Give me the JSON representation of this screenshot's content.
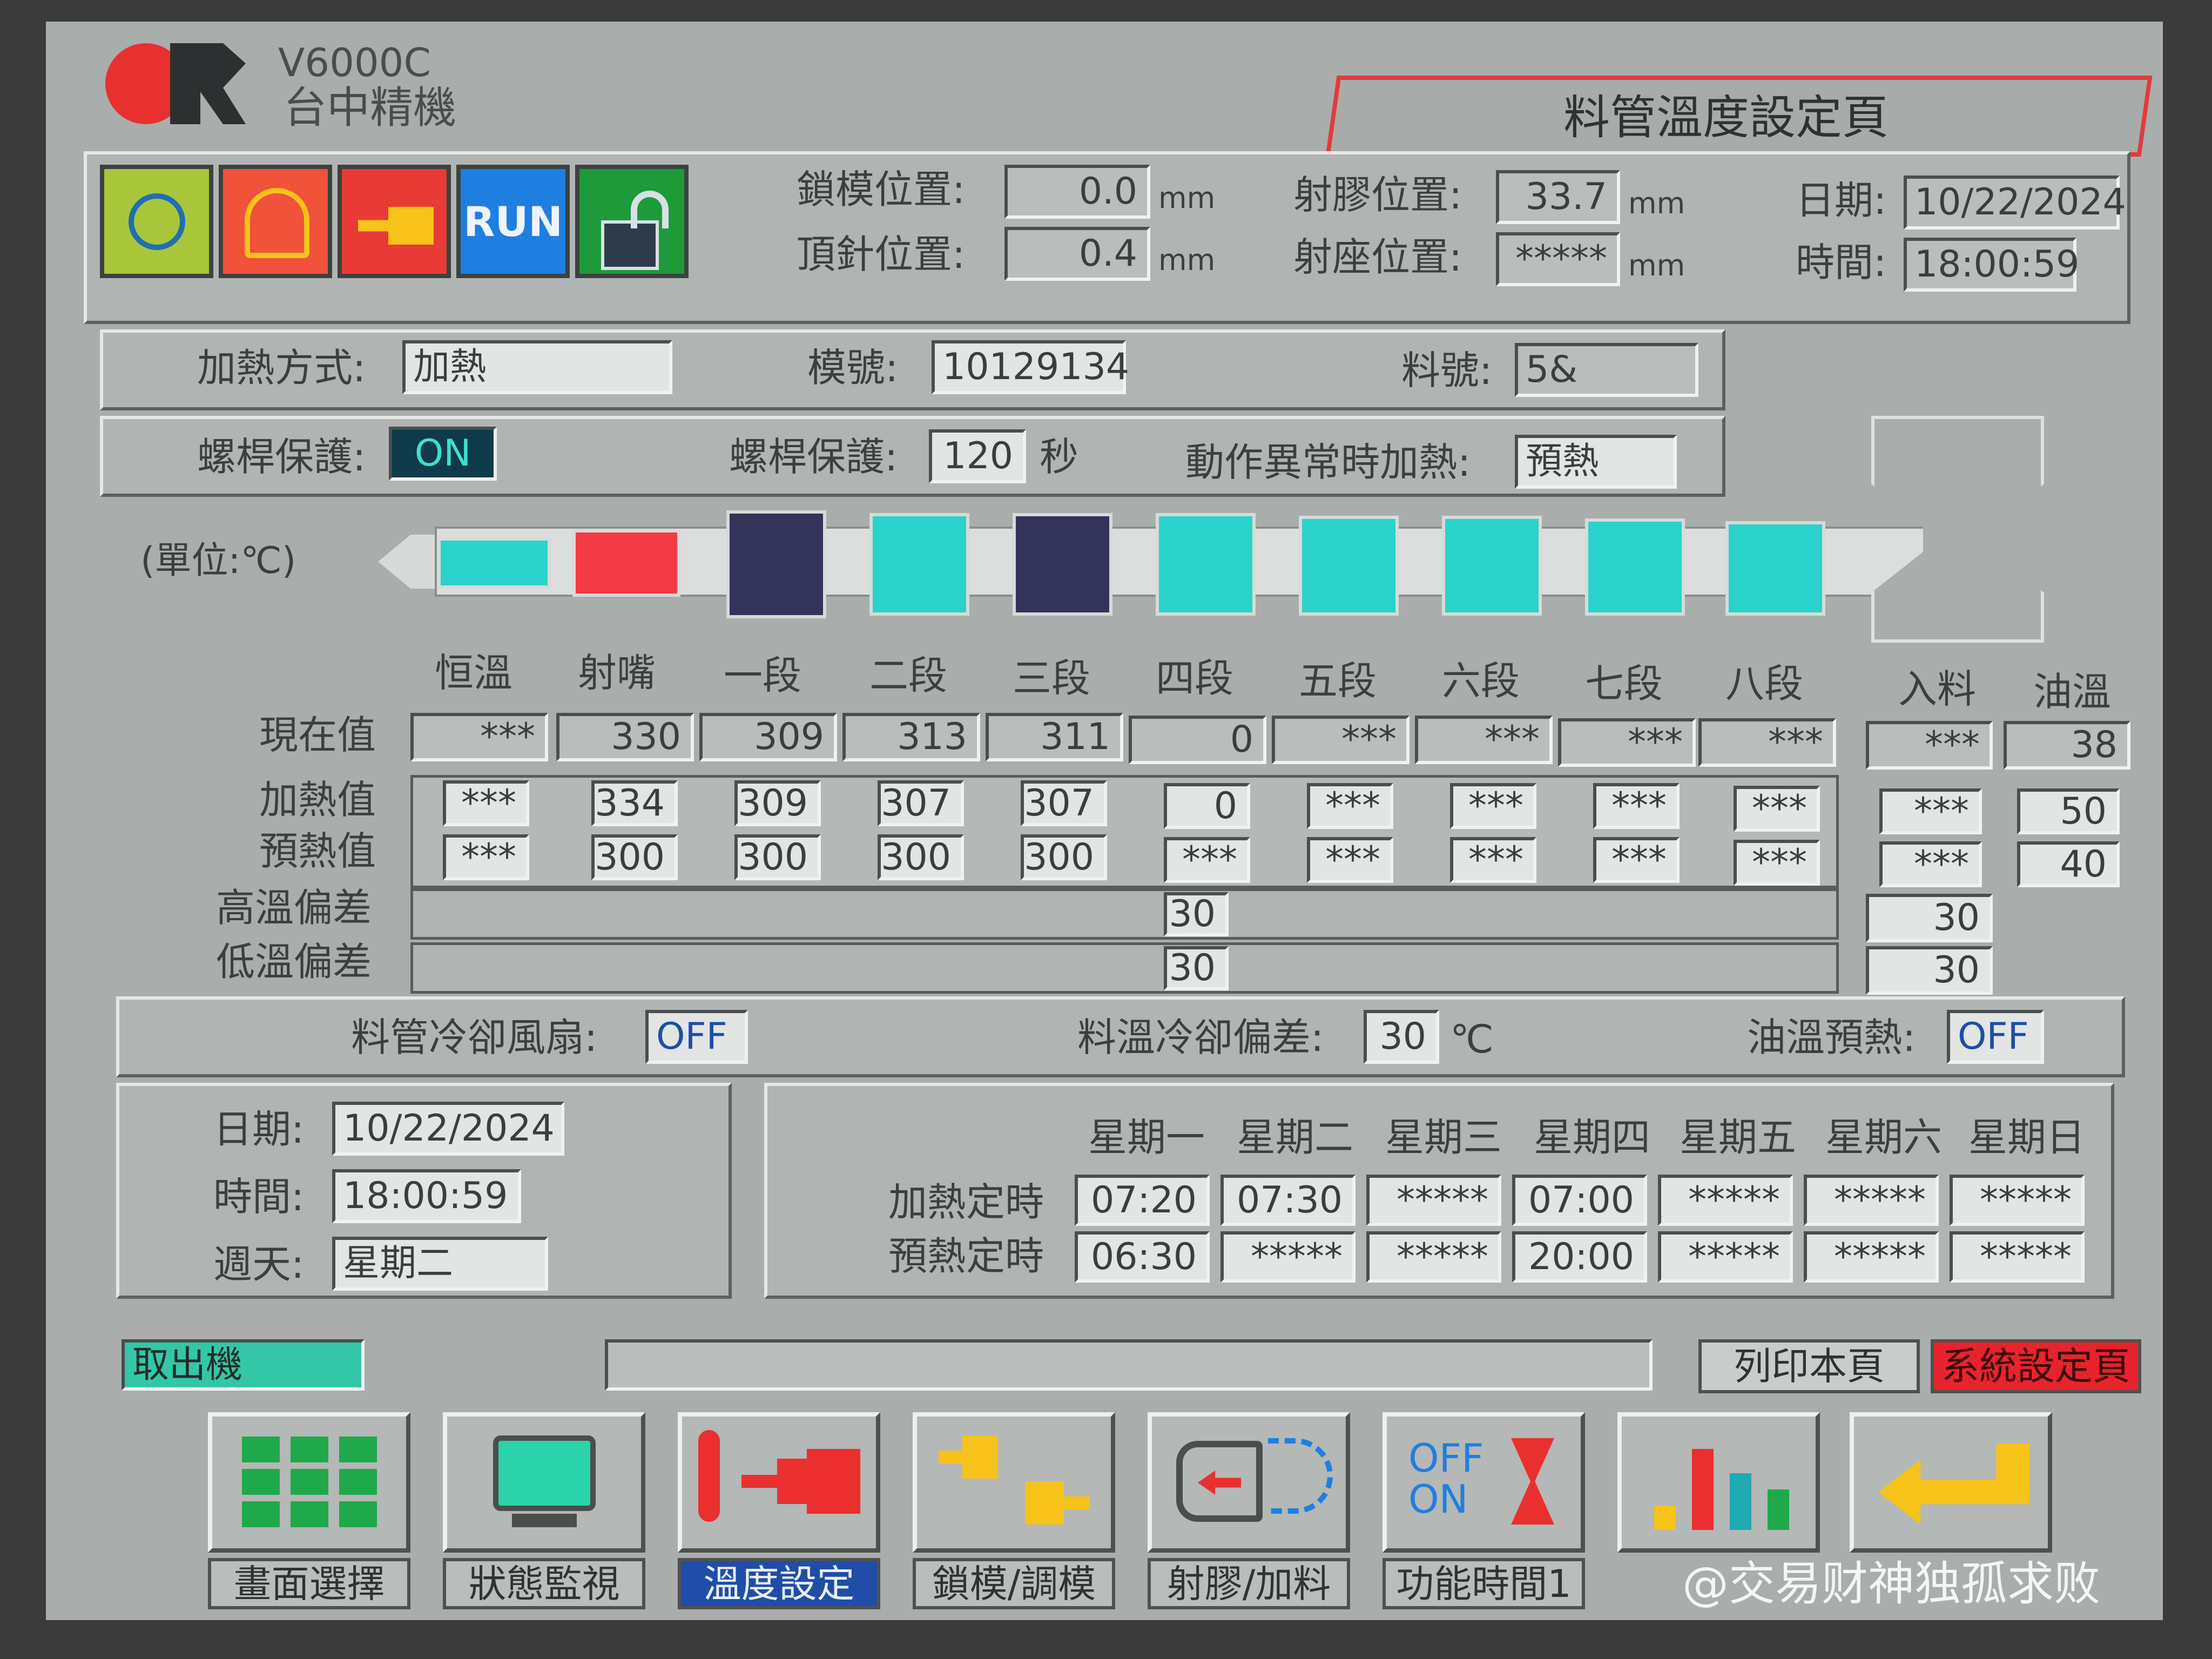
{
  "brand": {
    "model": "V6000C",
    "company": "台中精機"
  },
  "page_title": "料管溫度設定頁",
  "status_icons": {
    "run_label": "RUN"
  },
  "positions": {
    "mold_lock_label": "鎖模位置:",
    "mold_lock_value": "0.0",
    "mold_lock_unit": "mm",
    "ejector_label": "頂針位置:",
    "ejector_value": "0.4",
    "ejector_unit": "mm",
    "injection_label": "射膠位置:",
    "injection_value": "33.7",
    "injection_unit": "mm",
    "carriage_label": "射座位置:",
    "carriage_value": "*****",
    "carriage_unit": "mm",
    "date_label": "日期:",
    "date_value": "10/22/2024",
    "time_label": "時間:",
    "time_value": "18:00:59"
  },
  "heating": {
    "method_label": "加熱方式:",
    "method_value": "加熱",
    "mold_no_label": "模號:",
    "mold_no_value": "10129134",
    "material_label": "料號:",
    "material_value": "5&"
  },
  "screw": {
    "protect_label": "螺桿保護:",
    "protect_state": "ON",
    "protect_time_label": "螺桿保護:",
    "protect_time_value": "120",
    "protect_time_unit": "秒",
    "abnormal_label": "動作異常時加熱:",
    "abnormal_value": "預熱"
  },
  "unit_label": "(單位:℃)",
  "zone_table": {
    "columns": [
      "恒溫",
      "射嘴",
      "一段",
      "二段",
      "三段",
      "四段",
      "五段",
      "六段",
      "七段",
      "八段"
    ],
    "side_columns": [
      "入料",
      "油溫"
    ],
    "row_labels": {
      "current": "現在值",
      "heat": "加熱值",
      "preheat": "預熱值",
      "high_dev": "高溫偏差",
      "low_dev": "低溫偏差"
    },
    "current": [
      "***",
      "330",
      "309",
      "313",
      "311",
      "0",
      "***",
      "***",
      "***",
      "***"
    ],
    "heat": [
      "***",
      "334",
      "309",
      "307",
      "307",
      "0",
      "***",
      "***",
      "***",
      "***"
    ],
    "preheat": [
      "***",
      "300",
      "300",
      "300",
      "300",
      "***",
      "***",
      "***",
      "***",
      "***"
    ],
    "side_current": [
      "***",
      "38"
    ],
    "side_heat": [
      "***",
      "50"
    ],
    "side_preheat": [
      "***",
      "40"
    ],
    "high_dev": "30",
    "low_dev": "30",
    "side_high_dev": "30",
    "side_low_dev": "30"
  },
  "cooling": {
    "fan_label": "料管冷卻風扇:",
    "fan_value": "OFF",
    "dev_label": "料溫冷卻偏差:",
    "dev_value": "30",
    "dev_unit": "℃",
    "oil_preheat_label": "油溫預熱:",
    "oil_preheat_value": "OFF"
  },
  "clock": {
    "date_label": "日期:",
    "date_value": "10/22/2024",
    "time_label": "時間:",
    "time_value": "18:00:59",
    "weekday_label": "週天:",
    "weekday_value": "星期二"
  },
  "schedule": {
    "days": [
      "星期一",
      "星期二",
      "星期三",
      "星期四",
      "星期五",
      "星期六",
      "星期日"
    ],
    "heat_label": "加熱定時",
    "preheat_label": "預熱定時",
    "heat_times": [
      "07:20",
      "07:30",
      "*****",
      "07:00",
      "*****",
      "*****",
      "*****"
    ],
    "preheat_times": [
      "06:30",
      "*****",
      "*****",
      "20:00",
      "*****",
      "*****",
      "*****"
    ]
  },
  "bottom": {
    "robot_label": "取出機",
    "print_label": "列印本頁",
    "system_label": "系統設定頁"
  },
  "nav": [
    "畫面選擇",
    "狀態監視",
    "溫度設定",
    "鎖模/調模",
    "射膠/加料",
    "功能時間1"
  ],
  "watermark": "@交易财神独孤求败",
  "colors": {
    "zone_teal": "#2ad3c9",
    "zone_navy": "#34335a",
    "zone_red": "#f23b44",
    "selected_nav": "#1f4da8",
    "system_button": "#e8232b",
    "robot_indicator": "#33c7a7"
  }
}
